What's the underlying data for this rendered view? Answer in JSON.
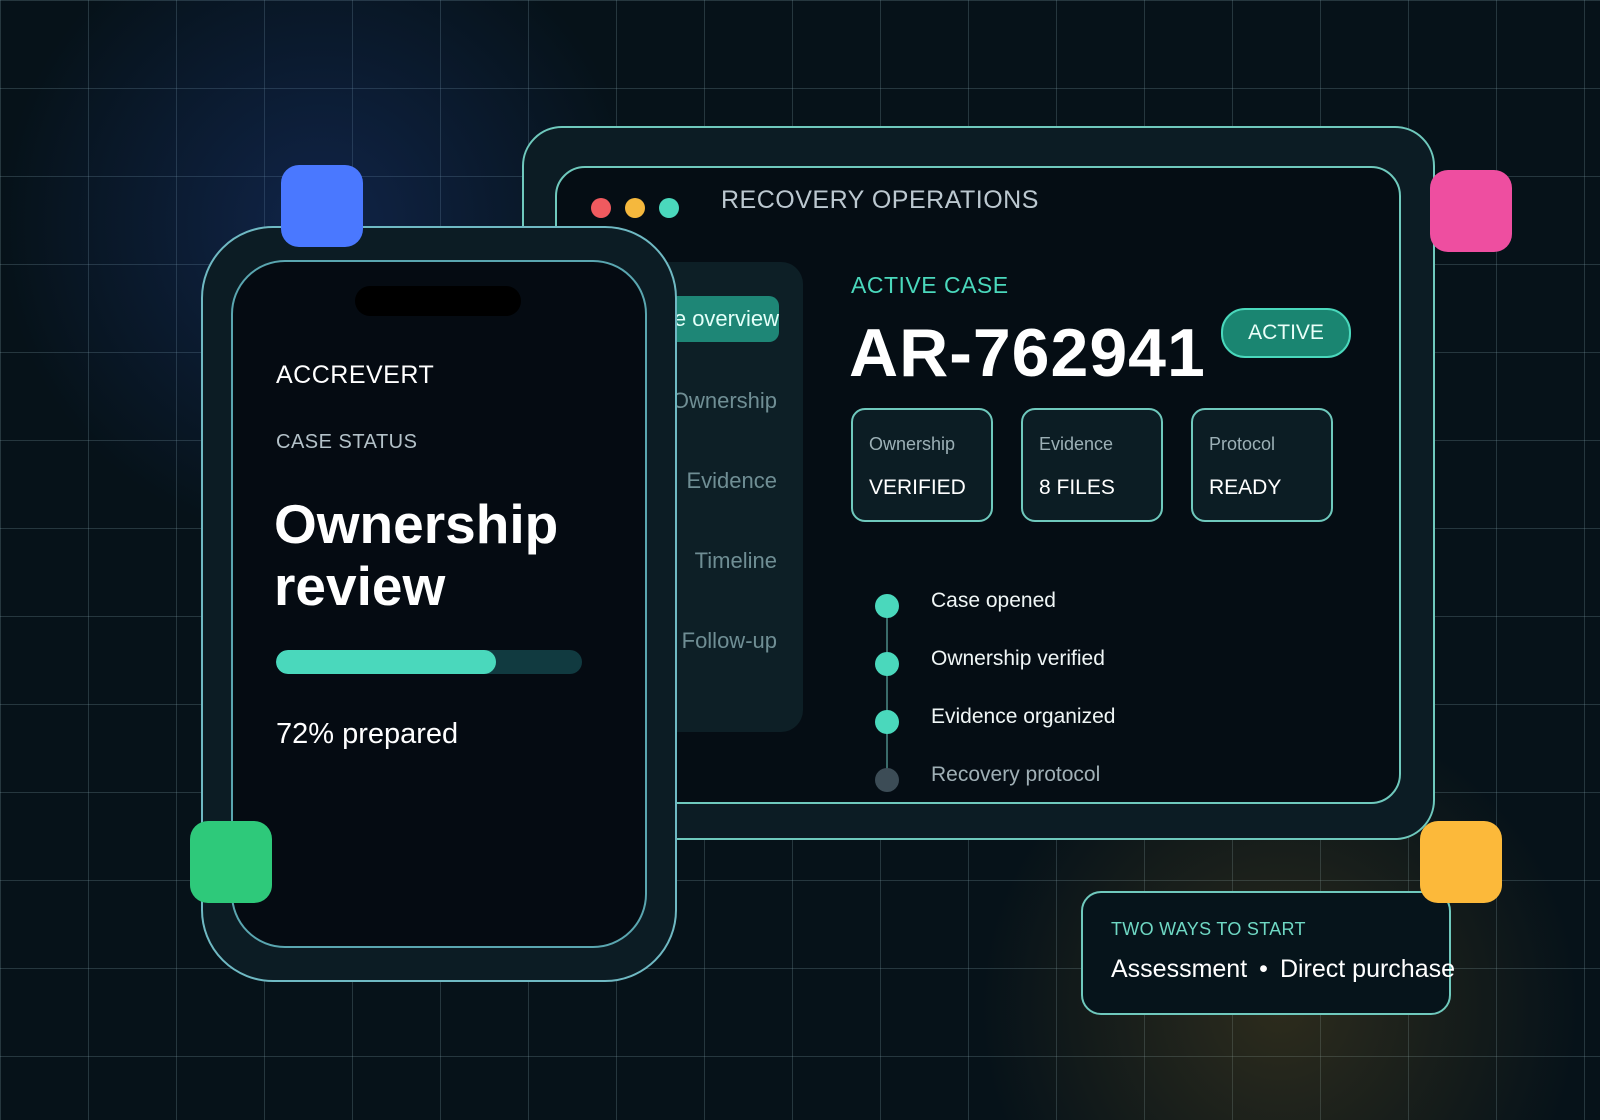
{
  "window": {
    "title": "RECOVERY OPERATIONS",
    "traffic_colors": [
      "#f05a5f",
      "#f5b83d",
      "#4ad8bc"
    ]
  },
  "sidebar": {
    "items": [
      {
        "label": "Case overview",
        "active": true
      },
      {
        "label": "Ownership",
        "active": false
      },
      {
        "label": "Evidence",
        "active": false
      },
      {
        "label": "Timeline",
        "active": false
      },
      {
        "label": "Follow-up",
        "active": false
      }
    ]
  },
  "case": {
    "section_label": "ACTIVE CASE",
    "id": "AR-762941",
    "status": "ACTIVE",
    "cards": [
      {
        "label": "Ownership",
        "value": "VERIFIED"
      },
      {
        "label": "Evidence",
        "value": "8 FILES"
      },
      {
        "label": "Protocol",
        "value": "READY"
      }
    ]
  },
  "timeline": {
    "steps": [
      {
        "label": "Case opened",
        "done": true
      },
      {
        "label": "Ownership verified",
        "done": true
      },
      {
        "label": "Evidence organized",
        "done": true
      },
      {
        "label": "Recovery protocol",
        "done": false
      }
    ]
  },
  "phone": {
    "brand": "ACCREVERT",
    "status_label": "CASE STATUS",
    "heading": "Ownership review",
    "progress": 0.72,
    "progress_text": "72% prepared"
  },
  "start": {
    "label": "TWO WAYS TO START",
    "option_a": "Assessment",
    "separator": "•",
    "option_b": "Direct purchase"
  },
  "colors": {
    "accent": "#4ad8bc",
    "deco_blue": "#4a78ff",
    "deco_pink": "#ee4ea0",
    "deco_green": "#2ec97a",
    "deco_yellow": "#fcb93a",
    "timeline_pending": "#3c4c56"
  }
}
